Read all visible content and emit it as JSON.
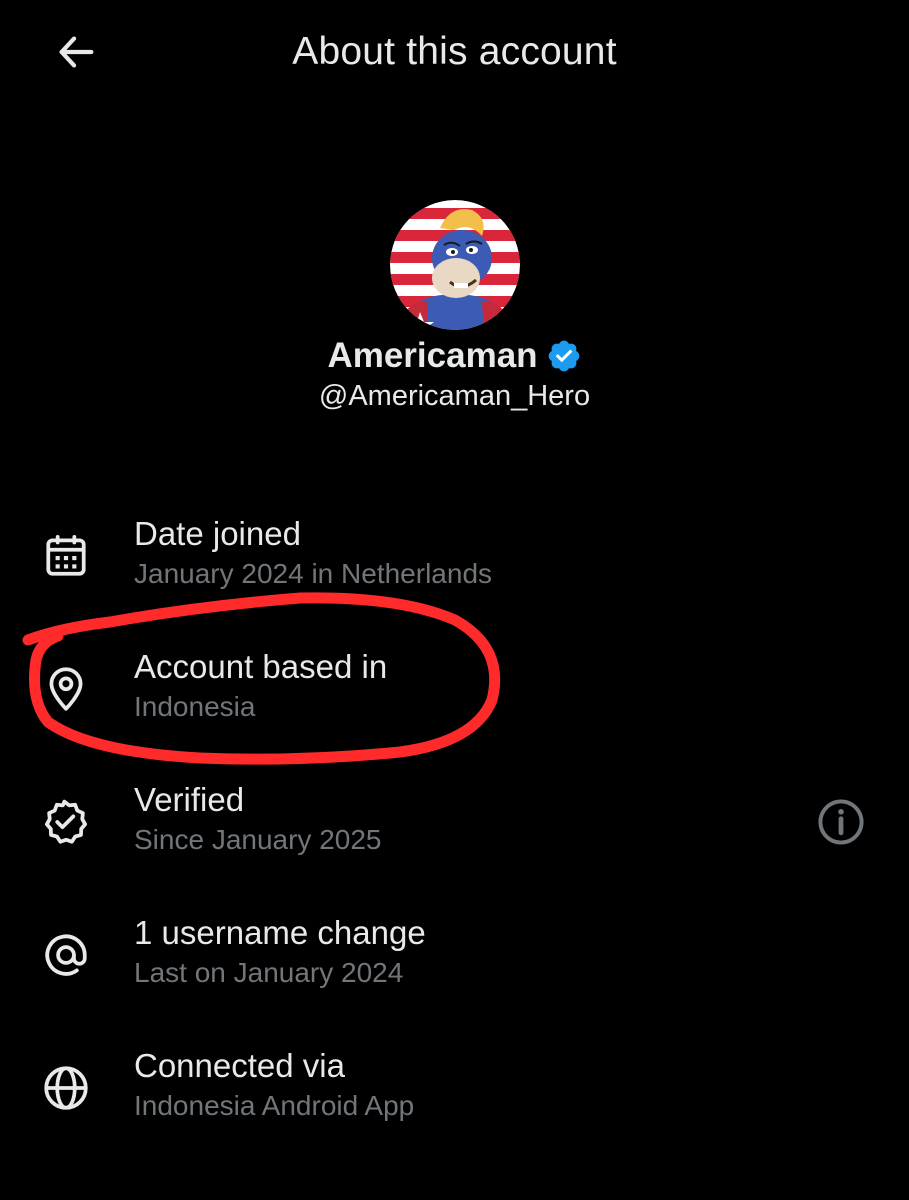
{
  "header": {
    "title": "About this account",
    "back_icon": "arrow-left-icon"
  },
  "profile": {
    "display_name": "Americaman",
    "handle": "@Americaman_Hero",
    "verified_icon": "verified-badge-icon",
    "verified_color": "#1d9bf0"
  },
  "info": {
    "date_joined": {
      "title": "Date joined",
      "subtitle": "January 2024 in Netherlands",
      "icon": "calendar-icon"
    },
    "account_based": {
      "title": "Account based in",
      "subtitle": "Indonesia",
      "icon": "location-pin-icon"
    },
    "verified": {
      "title": "Verified",
      "subtitle": "Since January 2025",
      "icon": "verified-outline-icon",
      "action_icon": "info-icon"
    },
    "username_change": {
      "title": "1 username change",
      "subtitle": "Last on January 2024",
      "icon": "at-sign-icon"
    },
    "connected_via": {
      "title": "Connected via",
      "subtitle": "Indonesia Android App",
      "icon": "globe-icon"
    }
  },
  "colors": {
    "background": "#000000",
    "primary_text": "#e7e9ea",
    "secondary_text": "#71767b",
    "annotation": "#ff2a2a"
  }
}
